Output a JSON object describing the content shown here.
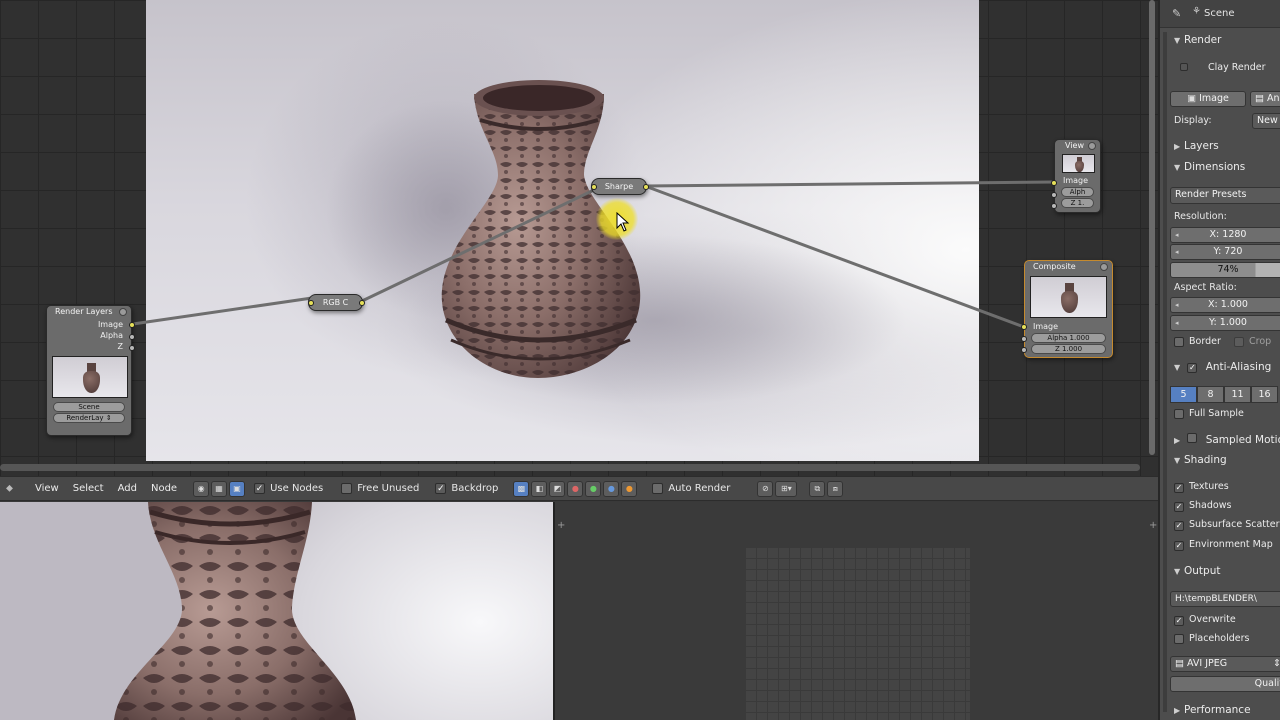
{
  "node_editor": {
    "nodes": {
      "render_layers": {
        "title": "Render Layers",
        "outputs": [
          "Image",
          "Alpha",
          "Z"
        ],
        "scene": "Scene",
        "layer": "RenderLay"
      },
      "rgb_curves": {
        "title": "RGB C"
      },
      "sharpen": {
        "title": "Sharpe"
      },
      "viewer": {
        "title": "View",
        "inputs": [
          "Image",
          "Alph",
          "Z 1."
        ]
      },
      "composite": {
        "title": "Composite",
        "inputs": [
          "Image",
          "Alpha 1.000",
          "Z 1.000"
        ]
      }
    },
    "header": {
      "menus": [
        "View",
        "Select",
        "Add",
        "Node"
      ],
      "use_nodes": "Use Nodes",
      "free_unused": "Free Unused",
      "backdrop": "Backdrop",
      "auto_render": "Auto Render"
    }
  },
  "properties": {
    "context": "Scene",
    "render_section": "Render",
    "clay_render": "Clay Render",
    "image_button": "Image",
    "anim_button": "An",
    "display_label": "Display:",
    "display_value": "New",
    "layers_section": "Layers",
    "dimensions_section": "Dimensions",
    "render_presets": "Render Presets",
    "resolution_label": "Resolution:",
    "res_x": "X: 1280",
    "res_y": "Y: 720",
    "res_percent": "74%",
    "aspect_label": "Aspect Ratio:",
    "aspect_x": "X: 1.000",
    "aspect_y": "Y: 1.000",
    "border": "Border",
    "crop": "Crop",
    "anti_aliasing": "Anti-Aliasing",
    "aa_samples": [
      "5",
      "8",
      "11",
      "16"
    ],
    "full_sample": "Full Sample",
    "sampled_motion": "Sampled Motion",
    "shading_section": "Shading",
    "shading_options": [
      "Textures",
      "Shadows",
      "Subsurface Scattering",
      "Environment Map"
    ],
    "output_section": "Output",
    "output_path": "H:\\tempBLENDER\\",
    "overwrite": "Overwrite",
    "placeholders": "Placeholders",
    "file_format": "AVI JPEG",
    "quality": "Qualit",
    "performance_section": "Performance"
  },
  "colors": {
    "accent_blue": "#5680c2",
    "socket_yellow": "#e6e05a",
    "composite_outline": "#c58a2e",
    "cursor_highlight": "#eede28"
  }
}
